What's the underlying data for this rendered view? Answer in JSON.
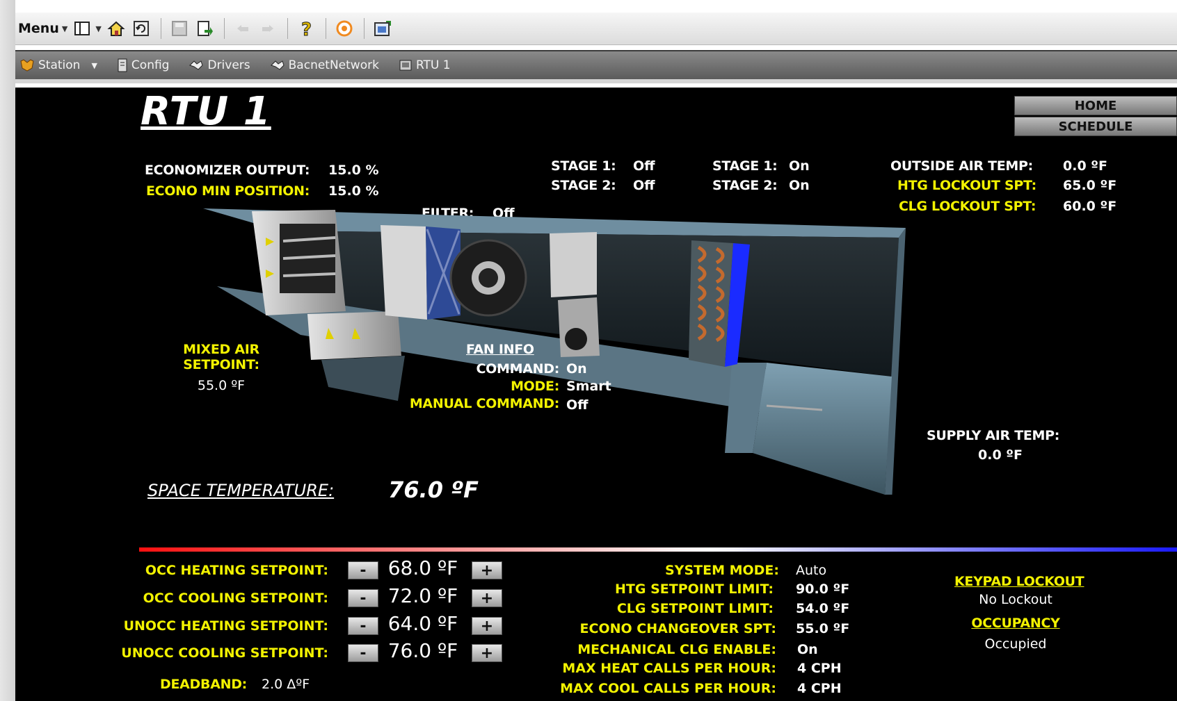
{
  "toolbar": {
    "menu_label": "Menu"
  },
  "nav": {
    "items": [
      {
        "label": "Station"
      },
      {
        "label": "Config"
      },
      {
        "label": "Drivers"
      },
      {
        "label": "BacnetNetwork"
      },
      {
        "label": "RTU 1"
      }
    ]
  },
  "page": {
    "title": "RTU 1",
    "home_label": "HOME",
    "schedule_label": "SCHEDULE"
  },
  "economizer": {
    "output_label": "ECONOMIZER OUTPUT:",
    "output_value": "15.0 %",
    "min_label": "ECONO MIN POSITION:",
    "min_value": "15.0 %"
  },
  "filter": {
    "label": "FILTER:",
    "value": "Off"
  },
  "heating_stages": {
    "stage1_label": "STAGE 1:",
    "stage1_value": "Off",
    "stage2_label": "STAGE 2:",
    "stage2_value": "Off"
  },
  "cooling_stages": {
    "stage1_label": "STAGE 1:",
    "stage1_value": "On",
    "stage2_label": "STAGE 2:",
    "stage2_value": "On"
  },
  "outside": {
    "oat_label": "OUTSIDE AIR TEMP:",
    "oat_value": "0.0 ºF",
    "htg_lockout_label": "HTG LOCKOUT SPT:",
    "htg_lockout_value": "65.0 ºF",
    "clg_lockout_label": "CLG LOCKOUT SPT:",
    "clg_lockout_value": "60.0 ºF"
  },
  "mixed_air": {
    "label_line1": "MIXED AIR",
    "label_line2": "SETPOINT:",
    "value": "55.0 ºF"
  },
  "fan": {
    "title": "FAN INFO",
    "command_label": "COMMAND:",
    "command_value": "On",
    "mode_label": "MODE:",
    "mode_value": "Smart",
    "manual_label": "MANUAL COMMAND:",
    "manual_value": "Off"
  },
  "supply": {
    "label": "SUPPLY AIR TEMP:",
    "value": "0.0 ºF"
  },
  "space": {
    "label": "SPACE TEMPERATURE:",
    "value": "76.0 ºF"
  },
  "setpoints": [
    {
      "label": "OCC HEATING SETPOINT:",
      "value": "68.0 ºF"
    },
    {
      "label": "OCC COOLING SETPOINT:",
      "value": "72.0 ºF"
    },
    {
      "label": "UNOCC HEATING SETPOINT:",
      "value": "64.0 ºF"
    },
    {
      "label": "UNOCC COOLING SETPOINT:",
      "value": "76.0 ºF"
    }
  ],
  "stepper": {
    "minus": "-",
    "plus": "+"
  },
  "deadband": {
    "label": "DEADBAND:",
    "value": "2.0 ΔºF"
  },
  "system": [
    {
      "label": "SYSTEM MODE:",
      "value": "Auto"
    },
    {
      "label": "HTG SETPOINT LIMIT:",
      "value": "90.0 ºF"
    },
    {
      "label": "CLG SETPOINT LIMIT:",
      "value": "54.0 ºF"
    },
    {
      "label": "ECONO CHANGEOVER SPT:",
      "value": "55.0 ºF"
    },
    {
      "label": "MECHANICAL CLG ENABLE:",
      "value": "On"
    },
    {
      "label": "MAX HEAT CALLS PER HOUR:",
      "value": "4 CPH"
    },
    {
      "label": "MAX COOL CALLS PER HOUR:",
      "value": "4 CPH"
    }
  ],
  "keypad": {
    "title": "KEYPAD LOCKOUT",
    "value": "No Lockout"
  },
  "occupancy": {
    "title": "OCCUPANCY",
    "value": "Occupied"
  }
}
